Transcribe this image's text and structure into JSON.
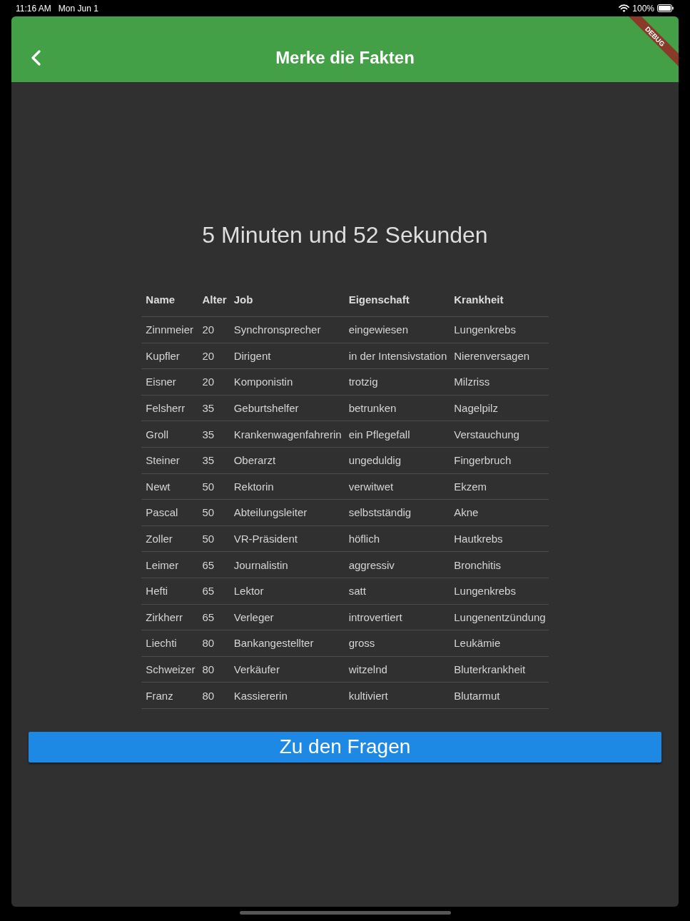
{
  "status_bar": {
    "time": "11:16 AM",
    "date": "Mon Jun 1",
    "battery": "100%"
  },
  "app_bar": {
    "title": "Merke die Fakten",
    "banner": "DEBUG"
  },
  "timer": "5 Minuten und 52 Sekunden",
  "table": {
    "columns": [
      "Name",
      "Alter",
      "Job",
      "Eigenschaft",
      "Krankheit"
    ],
    "rows": [
      [
        "Zinnmeier",
        "20",
        "Synchronsprecher",
        "eingewiesen",
        "Lungenkrebs"
      ],
      [
        "Kupfler",
        "20",
        "Dirigent",
        "in der Intensivstation",
        "Nierenversagen"
      ],
      [
        "Eisner",
        "20",
        "Komponistin",
        "trotzig",
        "Milzriss"
      ],
      [
        "Felsherr",
        "35",
        "Geburtshelfer",
        "betrunken",
        "Nagelpilz"
      ],
      [
        "Groll",
        "35",
        "Krankenwagenfahrerin",
        "ein Pflegefall",
        "Verstauchung"
      ],
      [
        "Steiner",
        "35",
        "Oberarzt",
        "ungeduldig",
        "Fingerbruch"
      ],
      [
        "Newt",
        "50",
        "Rektorin",
        "verwitwet",
        "Ekzem"
      ],
      [
        "Pascal",
        "50",
        "Abteilungsleiter",
        "selbstständig",
        "Akne"
      ],
      [
        "Zoller",
        "50",
        "VR-Präsident",
        "höflich",
        "Hautkrebs"
      ],
      [
        "Leimer",
        "65",
        "Journalistin",
        "aggressiv",
        "Bronchitis"
      ],
      [
        "Hefti",
        "65",
        "Lektor",
        "satt",
        "Lungenkrebs"
      ],
      [
        "Zirkherr",
        "65",
        "Verleger",
        "introvertiert",
        "Lungenentzündung"
      ],
      [
        "Liechti",
        "80",
        "Bankangestellter",
        "gross",
        "Leukämie"
      ],
      [
        "Schweizer",
        "80",
        "Verkäufer",
        "witzelnd",
        "Bluterkrankheit"
      ],
      [
        "Franz",
        "80",
        "Kassiererin",
        "kultiviert",
        "Blutarmut"
      ]
    ]
  },
  "primary_button": {
    "label": "Zu den Fragen"
  }
}
